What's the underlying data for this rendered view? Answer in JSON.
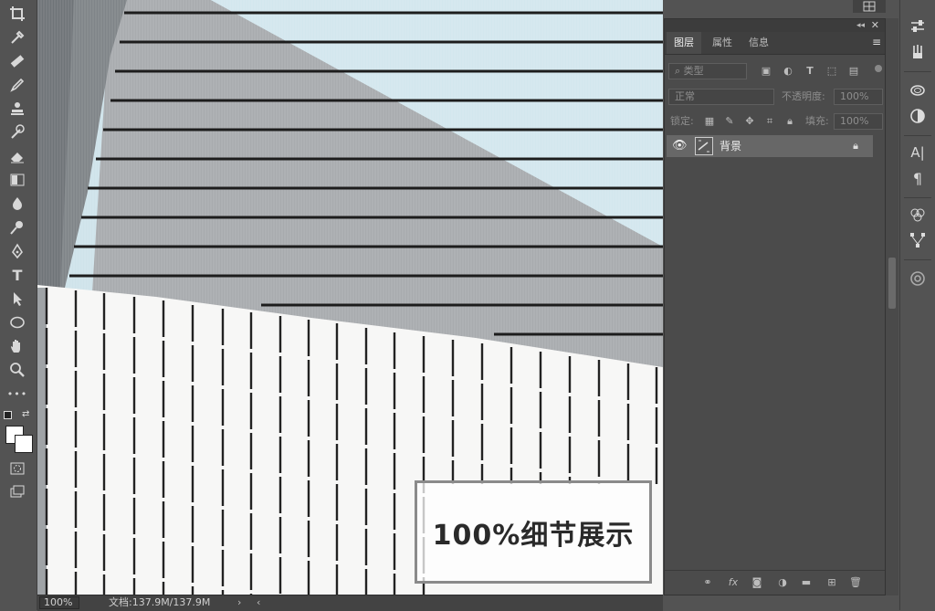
{
  "toolbar": {
    "tools": [
      "crop-icon",
      "eyedropper-icon",
      "healing-brush-icon",
      "brush-icon",
      "clone-stamp-icon",
      "history-brush-icon",
      "eraser-icon",
      "gradient-icon",
      "blur-icon",
      "dodge-icon",
      "pen-icon",
      "type-icon",
      "path-selection-icon",
      "ellipse-icon",
      "hand-icon",
      "zoom-icon",
      "more-tools-icon"
    ],
    "type_glyph": "T",
    "more_glyph": "•••"
  },
  "canvas": {
    "badge_text": "100%细节展示"
  },
  "status_bar": {
    "zoom": "100%",
    "doc_info": "文档:137.9M/137.9M",
    "arrow_right": "›",
    "arrow_left": "‹"
  },
  "layers_panel": {
    "tabs": [
      "图层",
      "属性",
      "信息"
    ],
    "filter_placeholder": "类型",
    "blend_mode": "正常",
    "opacity_label": "不透明度:",
    "opacity_value": "100%",
    "lock_label": "锁定:",
    "fill_label": "填充:",
    "fill_value": "100%",
    "layers": [
      {
        "name": "背景",
        "visible": true,
        "locked": true
      }
    ]
  },
  "dock": {
    "text_glyph": "A|",
    "paragraph_glyph": "¶"
  }
}
